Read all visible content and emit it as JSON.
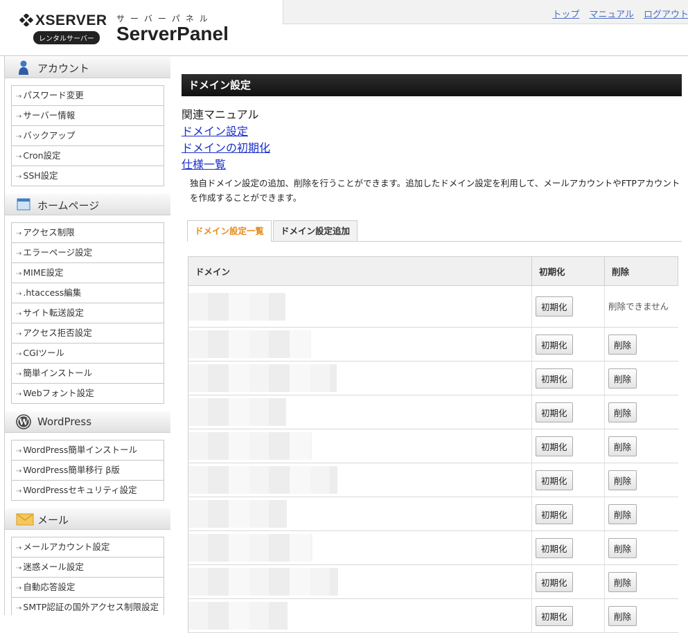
{
  "header": {
    "brand": "XSERVER",
    "brand_sub": "レンタルサーバー",
    "panel_kana": "サーバーパネル",
    "panel_name": "ServerPanel",
    "links": [
      "トップ",
      "マニュアル",
      "ログアウト"
    ]
  },
  "sidebar": {
    "sections": [
      {
        "title": "アカウント",
        "icon": "person-icon",
        "items": [
          "パスワード変更",
          "サーバー情報",
          "バックアップ",
          "Cron設定",
          "SSH設定"
        ]
      },
      {
        "title": "ホームページ",
        "icon": "window-icon",
        "items": [
          "アクセス制限",
          "エラーページ設定",
          "MIME設定",
          ".htaccess編集",
          "サイト転送設定",
          "アクセス拒否設定",
          "CGIツール",
          "簡単インストール",
          "Webフォント設定"
        ]
      },
      {
        "title": "WordPress",
        "icon": "wordpress-icon",
        "items": [
          "WordPress簡単インストール",
          "WordPress簡単移行 β版",
          "WordPressセキュリティ設定"
        ]
      },
      {
        "title": "メール",
        "icon": "envelope-icon",
        "items": [
          "メールアカウント設定",
          "迷惑メール設定",
          "自動応答設定",
          "SMTP認証の国外アクセス制限設定"
        ]
      }
    ]
  },
  "main": {
    "title": "ドメイン設定",
    "manual_heading": "関連マニュアル",
    "manual_links": [
      "ドメイン設定",
      "ドメインの初期化",
      "仕様一覧"
    ],
    "description": "独自ドメイン設定の追加、削除を行うことができます。追加したドメイン設定を利用して、メールアカウントやFTPアカウントを作成することができます。",
    "tabs": [
      "ドメイン設定一覧",
      "ドメイン設定追加"
    ],
    "table": {
      "headers": [
        "ドメイン",
        "初期化",
        "削除"
      ],
      "init_label": "初期化",
      "delete_label": "削除",
      "cannot_delete": "削除できません",
      "row_count": 10
    }
  }
}
